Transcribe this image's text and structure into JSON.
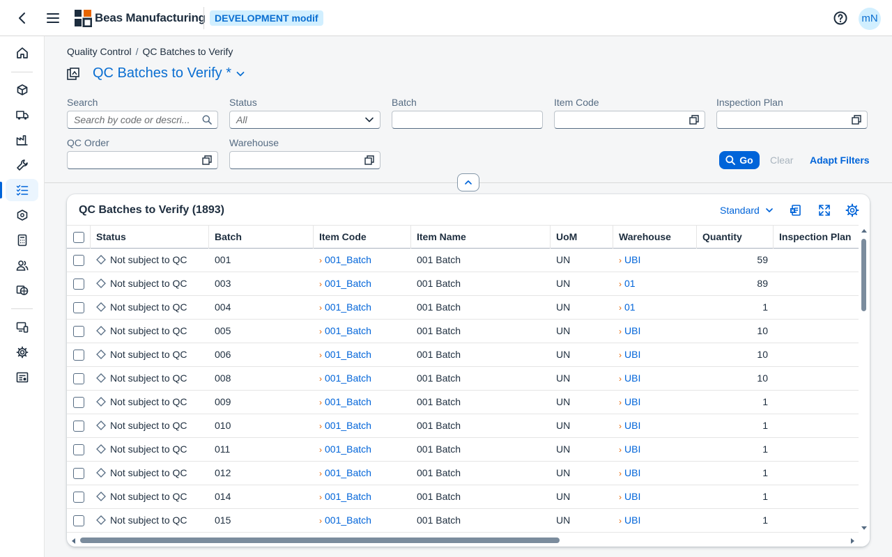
{
  "shell": {
    "brand": "Beas Manufacturing",
    "environment": "DEVELOPMENT modif",
    "user_initials": "mN"
  },
  "nav": {
    "items": [
      "home-icon",
      "cube-icon",
      "truck-icon",
      "factory-icon",
      "wrench-icon",
      "checklist-icon",
      "package-icon",
      "calculator-icon",
      "users-icon",
      "globe-icon",
      "devices-icon",
      "settings-icon",
      "report-icon"
    ],
    "active": "checklist-icon"
  },
  "breadcrumb": {
    "parent": "Quality Control",
    "current": "QC Batches to Verify"
  },
  "page": {
    "title": "QC Batches to Verify *"
  },
  "filters": {
    "search_label": "Search",
    "search_placeholder": "Search by code or descri...",
    "status_label": "Status",
    "status_value": "All",
    "batch_label": "Batch",
    "item_code_label": "Item Code",
    "inspection_plan_label": "Inspection Plan",
    "qc_order_label": "QC Order",
    "warehouse_label": "Warehouse",
    "go": "Go",
    "clear": "Clear",
    "adapt": "Adapt Filters"
  },
  "table": {
    "title": "QC Batches to Verify (1893)",
    "variant": "Standard",
    "columns": [
      "Status",
      "Batch",
      "Item Code",
      "Item Name",
      "UoM",
      "Warehouse",
      "Quantity",
      "Inspection Plan"
    ],
    "rows": [
      {
        "status": "Not subject to QC",
        "batch": "001",
        "item_code": "001_Batch",
        "item_name": "001 Batch",
        "uom": "UN",
        "warehouse": "UBI",
        "quantity": "59",
        "plan": ""
      },
      {
        "status": "Not subject to QC",
        "batch": "003",
        "item_code": "001_Batch",
        "item_name": "001 Batch",
        "uom": "UN",
        "warehouse": "01",
        "quantity": "89",
        "plan": ""
      },
      {
        "status": "Not subject to QC",
        "batch": "004",
        "item_code": "001_Batch",
        "item_name": "001 Batch",
        "uom": "UN",
        "warehouse": "01",
        "quantity": "1",
        "plan": ""
      },
      {
        "status": "Not subject to QC",
        "batch": "005",
        "item_code": "001_Batch",
        "item_name": "001 Batch",
        "uom": "UN",
        "warehouse": "UBI",
        "quantity": "10",
        "plan": ""
      },
      {
        "status": "Not subject to QC",
        "batch": "006",
        "item_code": "001_Batch",
        "item_name": "001 Batch",
        "uom": "UN",
        "warehouse": "UBI",
        "quantity": "10",
        "plan": ""
      },
      {
        "status": "Not subject to QC",
        "batch": "008",
        "item_code": "001_Batch",
        "item_name": "001 Batch",
        "uom": "UN",
        "warehouse": "UBI",
        "quantity": "10",
        "plan": ""
      },
      {
        "status": "Not subject to QC",
        "batch": "009",
        "item_code": "001_Batch",
        "item_name": "001 Batch",
        "uom": "UN",
        "warehouse": "UBI",
        "quantity": "1",
        "plan": ""
      },
      {
        "status": "Not subject to QC",
        "batch": "010",
        "item_code": "001_Batch",
        "item_name": "001 Batch",
        "uom": "UN",
        "warehouse": "UBI",
        "quantity": "1",
        "plan": ""
      },
      {
        "status": "Not subject to QC",
        "batch": "011",
        "item_code": "001_Batch",
        "item_name": "001 Batch",
        "uom": "UN",
        "warehouse": "UBI",
        "quantity": "1",
        "plan": ""
      },
      {
        "status": "Not subject to QC",
        "batch": "012",
        "item_code": "001_Batch",
        "item_name": "001 Batch",
        "uom": "UN",
        "warehouse": "UBI",
        "quantity": "1",
        "plan": ""
      },
      {
        "status": "Not subject to QC",
        "batch": "014",
        "item_code": "001_Batch",
        "item_name": "001 Batch",
        "uom": "UN",
        "warehouse": "UBI",
        "quantity": "1",
        "plan": ""
      },
      {
        "status": "Not subject to QC",
        "batch": "015",
        "item_code": "001_Batch",
        "item_name": "001 Batch",
        "uom": "UN",
        "warehouse": "UBI",
        "quantity": "1",
        "plan": ""
      }
    ]
  },
  "colors": {
    "accent": "#0064d9",
    "link": "#0064d9",
    "nav_arrow": "#e76500",
    "env_bg": "#d1efff"
  }
}
